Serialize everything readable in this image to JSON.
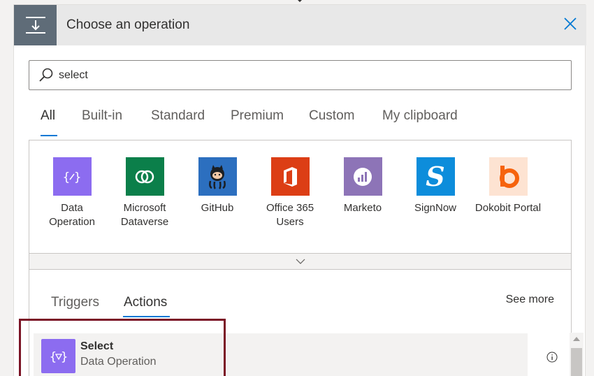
{
  "header": {
    "title": "Choose an operation",
    "icon": "trigger-step-icon",
    "close_icon": "close-icon"
  },
  "search": {
    "value": "select",
    "icon": "search-icon"
  },
  "tabs": [
    {
      "label": "All",
      "active": true
    },
    {
      "label": "Built-in"
    },
    {
      "label": "Standard"
    },
    {
      "label": "Premium"
    },
    {
      "label": "Custom"
    },
    {
      "label": "My clipboard"
    }
  ],
  "connectors": [
    {
      "label": "Data Operation",
      "icon": "data-operation-icon",
      "color": "#8c6cf0"
    },
    {
      "label": "Microsoft Dataverse",
      "icon": "dataverse-icon",
      "color": "#0b7f4a"
    },
    {
      "label": "GitHub",
      "icon": "github-icon",
      "color": "#2c6fbf"
    },
    {
      "label": "Office 365 Users",
      "icon": "office-365-icon",
      "color": "#dc3e15"
    },
    {
      "label": "Marketo",
      "icon": "marketo-icon",
      "color": "#8d74b7"
    },
    {
      "label": "SignNow",
      "icon": "signnow-icon",
      "color": "#0d8ddb"
    },
    {
      "label": "Dokobit Portal",
      "icon": "dokobit-icon",
      "color": "#f6630d"
    }
  ],
  "subtabs": [
    {
      "label": "Triggers"
    },
    {
      "label": "Actions",
      "active": true
    }
  ],
  "see_more": "See more",
  "result": {
    "title": "Select",
    "subtitle": "Data Operation",
    "icon": "data-operation-icon",
    "color": "#8c6cf0"
  },
  "colors": {
    "accent": "#0078d4",
    "highlight_border": "#7b1426"
  }
}
